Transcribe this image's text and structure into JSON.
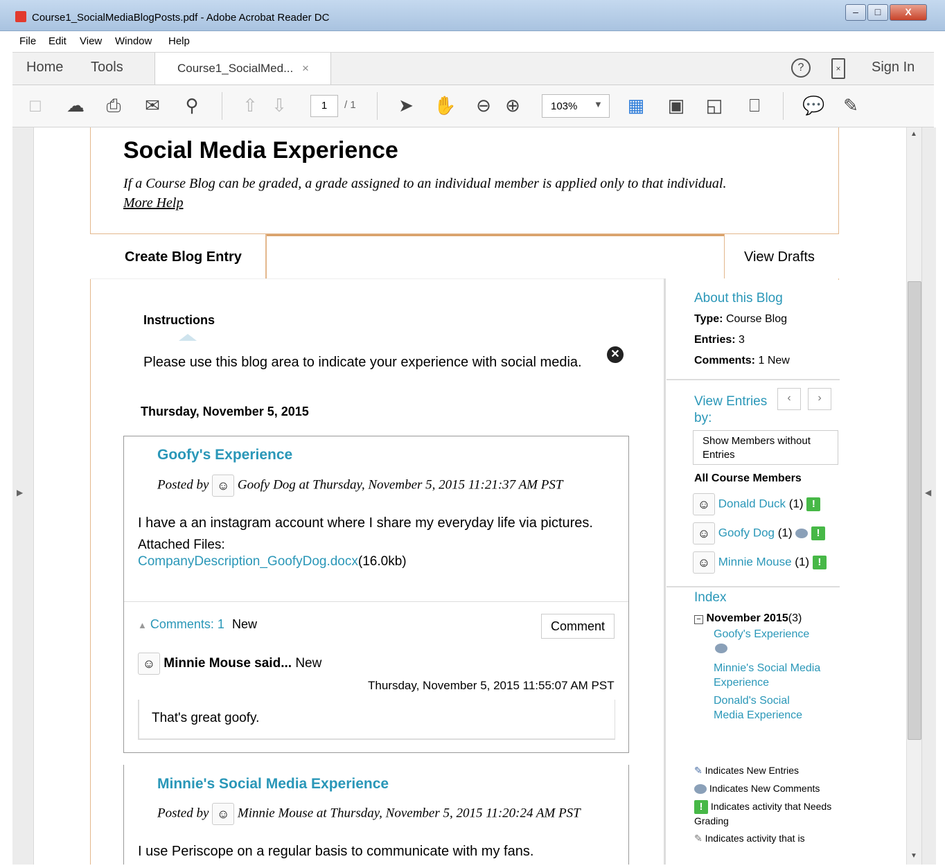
{
  "window": {
    "title": "Course1_SocialMediaBlogPosts.pdf - Adobe Acrobat Reader DC",
    "buttons": [
      "–",
      "□",
      "X"
    ]
  },
  "menu": [
    "File",
    "Edit",
    "View",
    "Window",
    "Help"
  ],
  "tabs": {
    "home": "Home",
    "tools": "Tools",
    "doc": "Course1_SocialMed...",
    "doc_close": "×",
    "sign_in": "Sign In"
  },
  "toolbar": {
    "page_current": "1",
    "page_total": "/ 1",
    "zoom": "103%"
  },
  "page": {
    "heading": "Social Media Experience",
    "subtitle": "If a Course Blog can be graded, a grade assigned to an individual member is applied only to that individual.",
    "more_help": "More Help",
    "create_tab": "Create Blog Entry",
    "drafts_tab": "View Drafts",
    "instructions_label": "Instructions",
    "instructions_text": "Please use this blog area to indicate your experience with social media.",
    "date_heading": "Thursday, November 5, 2015",
    "entries": [
      {
        "title": "Goofy's Experience",
        "posted_by": "Posted by",
        "author": "Goofy Dog",
        "timestamp": "at Thursday, November 5, 2015 11:21:37 AM PST",
        "body": "I have a an instagram account where I share my everyday life via pictures.",
        "attached_label": "Attached Files:",
        "file_name": "CompanyDescription_GoofyDog.docx",
        "file_size": "(16.0kb)",
        "comments_link": "Comments: 1",
        "comments_new": "New",
        "comment_button": "Comment",
        "comment": {
          "author": "Minnie Mouse said...",
          "new": "New",
          "time": "Thursday, November 5, 2015 11:55:07 AM PST",
          "text": "That's great goofy."
        }
      },
      {
        "title": "Minnie's Social Media Experience",
        "posted_by": "Posted by",
        "author": "Minnie Mouse",
        "timestamp": "at Thursday, November 5, 2015 11:20:24 AM PST",
        "body": "I use Periscope on a regular basis to communicate with my fans."
      }
    ]
  },
  "sidebar": {
    "about_title": "About this Blog",
    "type_label": "Type:",
    "type_value": "Course Blog",
    "entries_label": "Entries:",
    "entries_value": "3",
    "comments_label": "Comments:",
    "comments_value": "1",
    "comments_new": "New",
    "view_by": "View Entries by:",
    "show_members": "Show Members without Entries",
    "all_members": "All Course Members",
    "members": [
      {
        "name": "Donald Duck",
        "count": "(1)"
      },
      {
        "name": "Goofy Dog",
        "count": "(1)"
      },
      {
        "name": "Minnie Mouse",
        "count": "(1)"
      }
    ],
    "index_title": "Index",
    "index_month": "November 2015",
    "index_count": "(3)",
    "index_entries": [
      "Goofy's Experience",
      "Minnie's Social Media Experience",
      "Donald's Social Media Experience"
    ],
    "legend": [
      "Indicates New Entries",
      "Indicates New Comments",
      "Indicates activity that Needs Grading",
      "Indicates activity that is"
    ]
  },
  "colors": {
    "link": "#2a97b8",
    "accent_border": "#e3b78c",
    "badge": "#47b847"
  }
}
